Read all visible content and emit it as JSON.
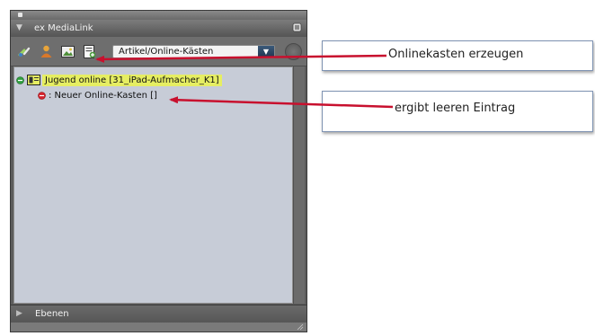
{
  "panel": {
    "title": "ex MediaLink",
    "select": {
      "value": "Artikel/Online-Kästen"
    },
    "tree": {
      "item1": {
        "label": "Jugend online [31_iPad-Aufmacher_K1]"
      },
      "item2": {
        "label": ": Neuer Online-Kasten []"
      }
    },
    "ebenen": {
      "label": "Ebenen"
    }
  },
  "callouts": {
    "create": "Onlinekasten erzeugen",
    "empty": "ergibt leeren Eintrag"
  },
  "colors": {
    "highlight": "#e6ee62",
    "arrow": "#c8102e",
    "status_green": "#2f9e3f",
    "status_red": "#d4232d",
    "panel_bg": "#c7ccd7"
  },
  "icons": {
    "toolbar": [
      "link-icon",
      "person-icon",
      "image-icon",
      "new-online-box-icon"
    ],
    "select_arrow": "chevron-down-icon"
  }
}
